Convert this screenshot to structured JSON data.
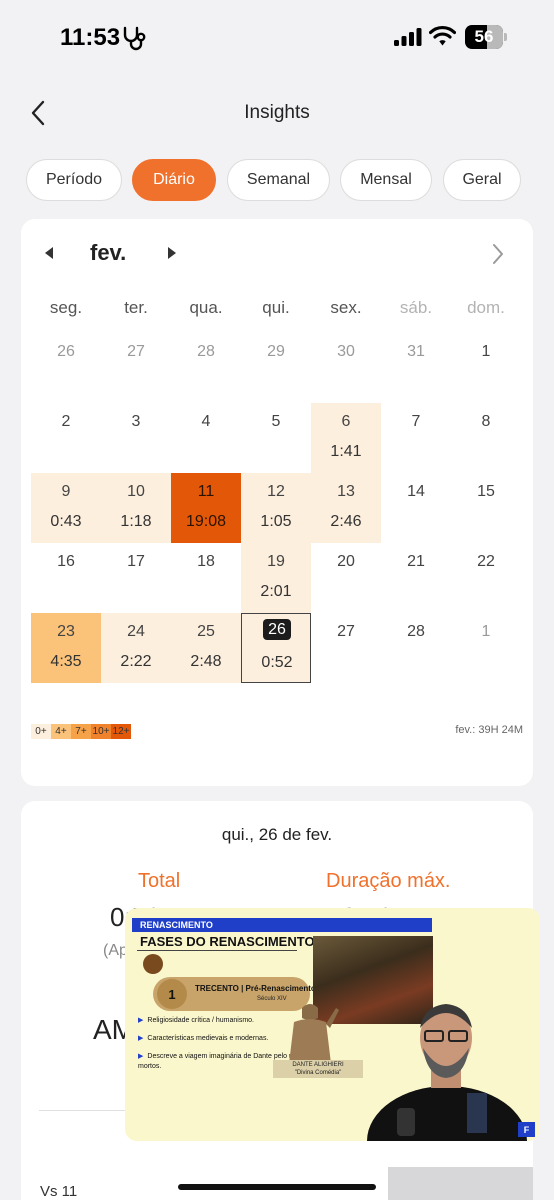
{
  "status_bar": {
    "time": "11:53",
    "battery": "56",
    "icons": [
      "stethoscope-icon",
      "signal-icon",
      "wifi-icon",
      "battery-icon"
    ]
  },
  "header": {
    "title": "Insights",
    "back_icon": "chevron-left-icon"
  },
  "tabs": [
    {
      "label": "Período",
      "active": false
    },
    {
      "label": "Diário",
      "active": true
    },
    {
      "label": "Semanal",
      "active": false
    },
    {
      "label": "Mensal",
      "active": false
    },
    {
      "label": "Geral",
      "active": false
    }
  ],
  "calendar": {
    "month": "fev.",
    "weekdays": [
      "seg.",
      "ter.",
      "qua.",
      "qui.",
      "sex.",
      "sáb.",
      "dom."
    ],
    "weeks": [
      [
        {
          "day": "26",
          "other": true
        },
        {
          "day": "27",
          "other": true
        },
        {
          "day": "28",
          "other": true
        },
        {
          "day": "29",
          "other": true
        },
        {
          "day": "30",
          "other": true
        },
        {
          "day": "31",
          "other": true
        },
        {
          "day": "1"
        }
      ],
      [
        {
          "day": "2"
        },
        {
          "day": "3"
        },
        {
          "day": "4"
        },
        {
          "day": "5"
        },
        {
          "day": "6",
          "dur": "1:41",
          "level": 1
        },
        {
          "day": "7"
        },
        {
          "day": "8"
        }
      ],
      [
        {
          "day": "9",
          "dur": "0:43",
          "level": 1
        },
        {
          "day": "10",
          "dur": "1:18",
          "level": 1
        },
        {
          "day": "11",
          "dur": "19:08",
          "level": 5
        },
        {
          "day": "12",
          "dur": "1:05",
          "level": 1
        },
        {
          "day": "13",
          "dur": "2:46",
          "level": 1
        },
        {
          "day": "14"
        },
        {
          "day": "15"
        }
      ],
      [
        {
          "day": "16"
        },
        {
          "day": "17"
        },
        {
          "day": "18"
        },
        {
          "day": "19",
          "dur": "2:01",
          "level": 1
        },
        {
          "day": "20"
        },
        {
          "day": "21"
        },
        {
          "day": "22"
        }
      ],
      [
        {
          "day": "23",
          "dur": "4:35",
          "level": 2
        },
        {
          "day": "24",
          "dur": "2:22",
          "level": 1
        },
        {
          "day": "25",
          "dur": "2:48",
          "level": 1
        },
        {
          "day": "26",
          "dur": "0:52",
          "level": 1,
          "today": true
        },
        {
          "day": "27"
        },
        {
          "day": "28"
        },
        {
          "day": "1",
          "other": true
        }
      ]
    ],
    "legend": [
      {
        "label": "0+",
        "color": "#fdefde"
      },
      {
        "label": "4+",
        "color": "#fbc37a"
      },
      {
        "label": "7+",
        "color": "#f6a248"
      },
      {
        "label": "10+",
        "color": "#f0822c"
      },
      {
        "label": "12+",
        "color": "#e35708"
      }
    ],
    "month_total": "fev.: 39H 24M"
  },
  "detail": {
    "date": "qui., 26 de fev.",
    "total_label": "Total",
    "total_value": "0:52:17",
    "total_sub": "(Ap",
    "max_label": "Duração máx.",
    "max_value": "0:52:17",
    "am_text": "AM",
    "vs_label": "Vs 11"
  },
  "pip": {
    "banner": "RENASCIMENTO",
    "title": "FASES DO RENASCIMENTO",
    "item_number": "1",
    "item_title": "TRECENTO | Pré-Renascimento",
    "item_sub": "Século XIV",
    "bullets": [
      "Religiosidade crítica / humanismo.",
      "Características medievais e modernas.",
      "Descreve a viagem imaginária de Dante pelo reino dos mortos."
    ],
    "caption_line1": "DANTE ALIGHIERI",
    "caption_line2": "\"Divina Comédia\"",
    "logo": "F"
  }
}
